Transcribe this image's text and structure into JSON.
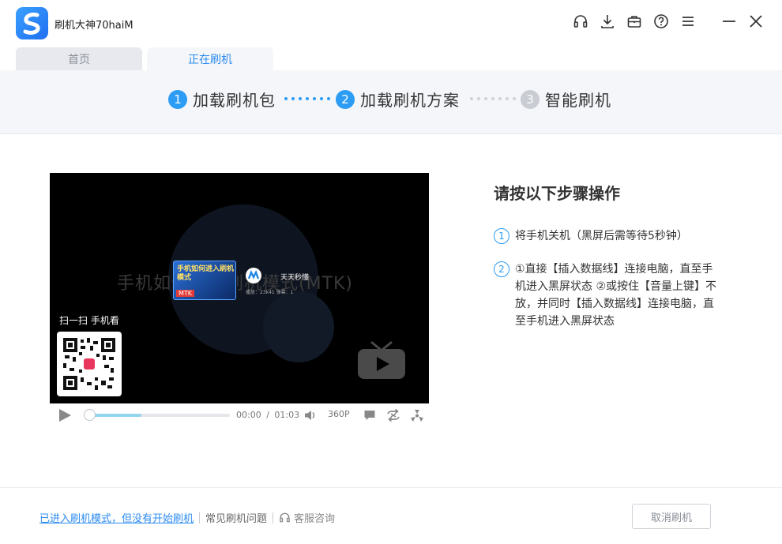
{
  "app": {
    "title": "刷机大神70haiM",
    "logo_letter": "S"
  },
  "window_controls": [
    "headset-icon",
    "download-icon",
    "briefcase-icon",
    "help-icon",
    "menu-icon",
    "minimize-icon",
    "close-icon"
  ],
  "tabs": [
    {
      "label": "首页",
      "active": false
    },
    {
      "label": "正在刷机",
      "active": true
    }
  ],
  "steps": [
    {
      "num": "1",
      "label": "加载刷机包",
      "state": "done"
    },
    {
      "num": "2",
      "label": "加载刷机方案",
      "state": "current"
    },
    {
      "num": "3",
      "label": "智能刷机",
      "state": "pending"
    }
  ],
  "video": {
    "bg_title": "手机如何进入刷机模式(MTK)",
    "thumb_title": "手机如何进入刷机模式",
    "thumb_tag": "MTK",
    "channel_name": "天天秒懂",
    "channel_stats": "播放：23k41   弹幕：1",
    "scan_label": "扫一扫 手机看",
    "current_time": "00:00",
    "time_sep": "/",
    "duration": "01:03",
    "quality": "360P",
    "buffered_fraction": 0.37
  },
  "instructions": {
    "title": "请按以下步骤操作",
    "items": [
      {
        "num": "1",
        "text": "将手机关机（黑屏后需等待5秒钟）"
      },
      {
        "num": "2",
        "text": "①直接【插入数据线】连接电脑，直至手机进入黑屏状态 ②或按住【音量上键】不放，并同时【插入数据线】连接电脑，直至手机进入黑屏状态"
      }
    ]
  },
  "footer": {
    "link_entered": "已进入刷机模式，但没有开始刷机",
    "link_faq": "常见刷机问题",
    "support": "客服咨询",
    "cancel": "取消刷机"
  },
  "colors": {
    "accent": "#2d8cf0",
    "step_active": "#2d9cf5",
    "step_inactive": "#c9ccd2"
  }
}
